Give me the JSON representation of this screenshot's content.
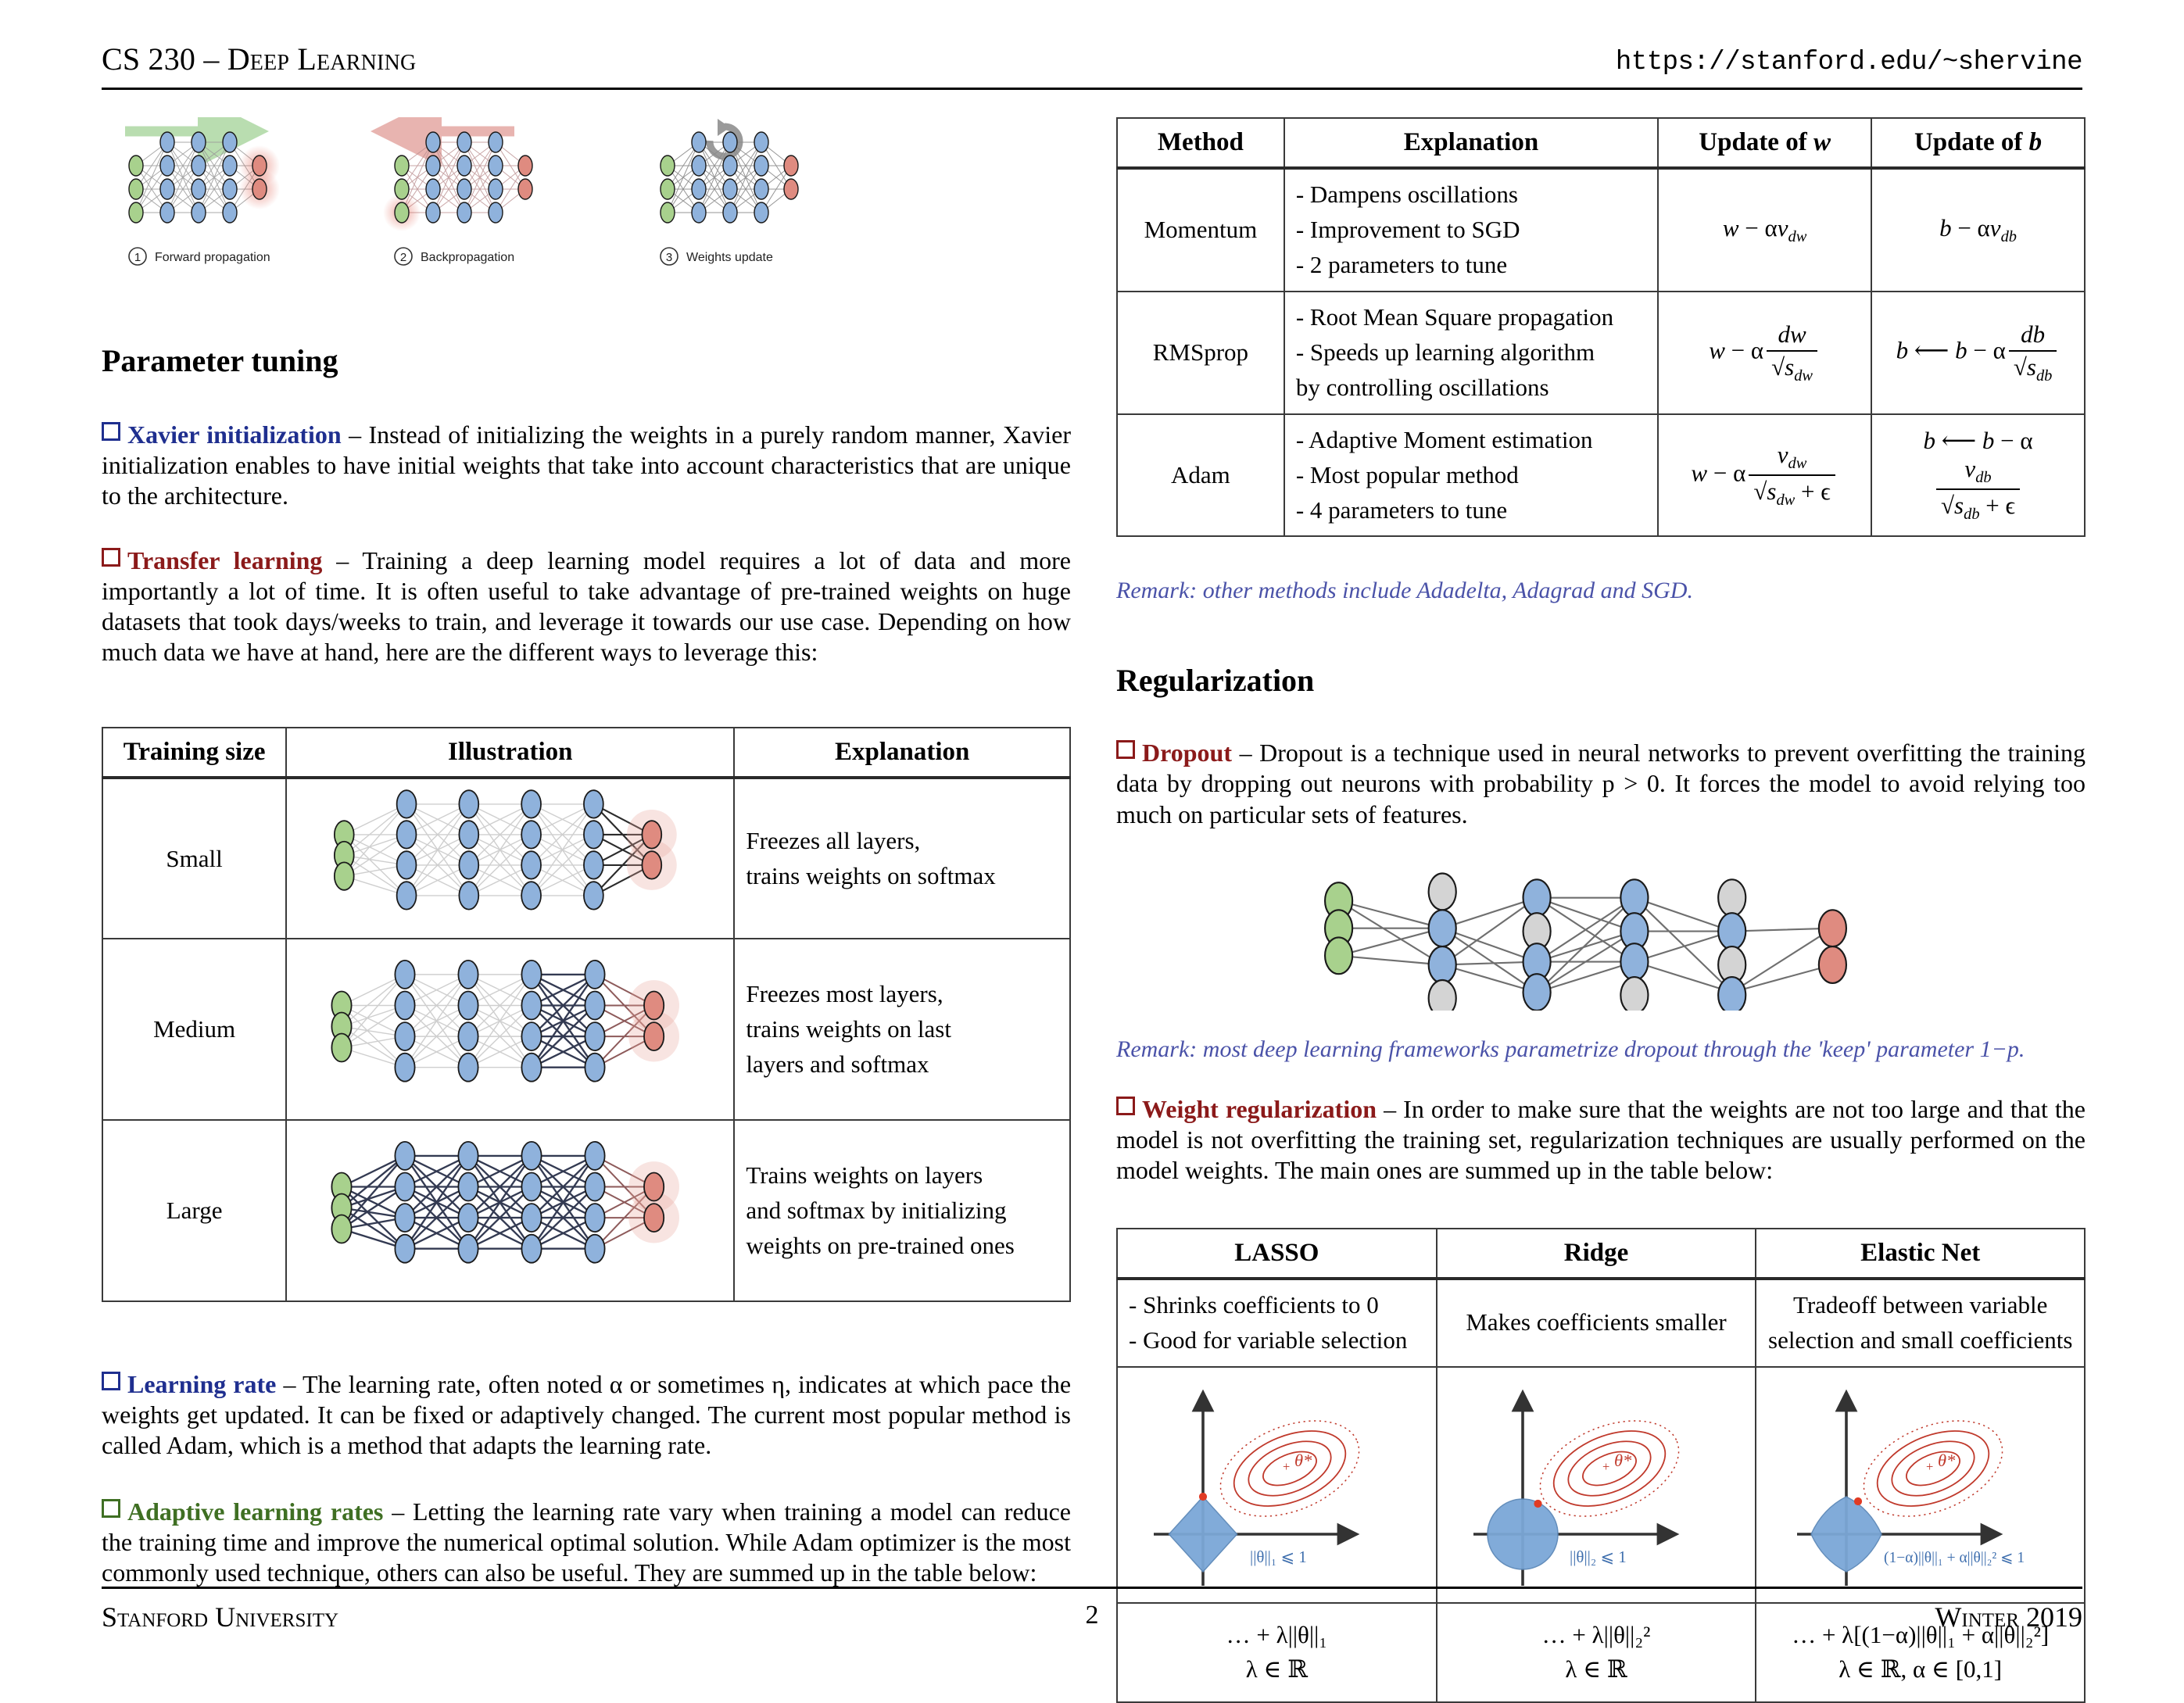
{
  "header": {
    "course": "CS 230 – Deep Learning",
    "url": "https://stanford.edu/~shervine"
  },
  "footer": {
    "university": "Stanford University",
    "page": "2",
    "term": "Winter 2019"
  },
  "colors": {
    "blue": "#1f2f8f",
    "red": "#8b1a1a",
    "green": "#3f6f23",
    "remark": "#4a52a8",
    "node_input": "#a8d18d",
    "node_hidden": "#8fb2dc",
    "node_output": "#df8b80",
    "node_dropped": "#d4d4d4",
    "arrow_forward": "#b9ddb0",
    "arrow_backward": "#e8b4b0",
    "constraint_fill": "#7ba7d7",
    "contour": "#c0392b"
  },
  "training_loop": {
    "steps": [
      {
        "number": "1",
        "label": "Forward propagation"
      },
      {
        "number": "2",
        "label": "Backpropagation"
      },
      {
        "number": "3",
        "label": "Weights update"
      }
    ]
  },
  "parameter_tuning": {
    "heading": "Parameter tuning",
    "xavier": {
      "term": "Xavier initialization",
      "dash": "–",
      "body": "Instead of initializing the weights in a purely random manner, Xavier initialization enables to have initial weights that take into account characteristics that are unique to the architecture."
    },
    "transfer": {
      "term": "Transfer learning",
      "dash": "–",
      "body": "Training a deep learning model requires a lot of data and more importantly a lot of time. It is often useful to take advantage of pre-trained weights on huge datasets that took days/weeks to train, and leverage it towards our use case. Depending on how much data we have at hand, here are the different ways to leverage this:"
    },
    "learning_rate": {
      "term": "Learning rate",
      "dash": "–",
      "body": "The learning rate, often noted α or sometimes η, indicates at which pace the weights get updated. It can be fixed or adaptively changed. The current most popular method is called Adam, which is a method that adapts the learning rate."
    },
    "adaptive": {
      "term": "Adaptive learning rates",
      "dash": "–",
      "body": "Letting the learning rate vary when training a model can reduce the training time and improve the numerical optimal solution. While Adam optimizer is the most commonly used technique, others can also be useful. They are summed up in the table below:"
    }
  },
  "transfer_table": {
    "headers": [
      "Training size",
      "Illustration",
      "Explanation"
    ],
    "rows": [
      {
        "size": "Small",
        "explanation": [
          "Freezes all layers,",
          "trains weights on softmax"
        ],
        "trained_layers": 1
      },
      {
        "size": "Medium",
        "explanation": [
          "Freezes most layers,",
          "trains weights on last",
          "layers and softmax"
        ],
        "trained_layers": 2
      },
      {
        "size": "Large",
        "explanation": [
          "Trains weights on layers",
          "and softmax by initializing",
          "weights on pre-trained ones"
        ],
        "trained_layers": 5
      }
    ]
  },
  "optimizer_table": {
    "headers": [
      "Method",
      "Explanation",
      "Update of w",
      "Update of b"
    ],
    "rows": [
      {
        "method": "Momentum",
        "explanation": [
          "- Dampens oscillations",
          "- Improvement to SGD",
          "- 2 parameters to tune"
        ],
        "update_w": "w − αv_dw",
        "update_b": "b − αv_db"
      },
      {
        "method": "RMSprop",
        "explanation": [
          "- Root Mean Square propagation",
          "- Speeds up learning algorithm",
          "by controlling oscillations"
        ],
        "update_w": "w − α dw / √s_dw",
        "update_b": "b ⟵ b − α db / √s_db"
      },
      {
        "method": "Adam",
        "explanation": [
          "- Adaptive Moment estimation",
          "- Most popular method",
          "- 4 parameters to tune"
        ],
        "update_w": "w − α v_dw / (√s_dw + ε)",
        "update_b": "b ⟵ b − α v_db / (√s_db + ε)"
      }
    ]
  },
  "optimizer_remark": "Remark: other methods include Adadelta, Adagrad and SGD.",
  "regularization": {
    "heading": "Regularization",
    "dropout": {
      "term": "Dropout",
      "dash": "–",
      "body": "Dropout is a technique used in neural networks to prevent overfitting the training data by dropping out neurons with probability p > 0. It forces the model to avoid relying too much on particular sets of features."
    },
    "dropout_remark": "Remark: most deep learning frameworks parametrize dropout through the 'keep' parameter 1−p.",
    "weight_reg": {
      "term": "Weight regularization",
      "dash": "–",
      "body": "In order to make sure that the weights are not too large and that the model is not overfitting the training set, regularization techniques are usually performed on the model weights. The main ones are summed up in the table below:"
    }
  },
  "regularization_table": {
    "headers": [
      "LASSO",
      "Ridge",
      "Elastic Net"
    ],
    "descriptions": [
      [
        "- Shrinks coefficients to 0",
        "- Good for variable selection"
      ],
      [
        "Makes coefficients smaller"
      ],
      [
        "Tradeoff between variable",
        "selection and small coefficients"
      ]
    ],
    "plot_labels": [
      "||θ||₁ ⩽ 1",
      "||θ||₂ ⩽ 1",
      "(1−α)||θ||₁ + α||θ||₂² ⩽ 1"
    ],
    "plot_optimum_label": "θ*",
    "formulas": [
      {
        "main": "… + λ||θ||₁",
        "constraint": "λ ∈ ℝ"
      },
      {
        "main": "… + λ||θ||₂²",
        "constraint": "λ ∈ ℝ"
      },
      {
        "main": "… + λ[(1−α)||θ||₁ + α||θ||₂²]",
        "constraint": "λ ∈ ℝ, α ∈ [0,1]"
      }
    ]
  }
}
